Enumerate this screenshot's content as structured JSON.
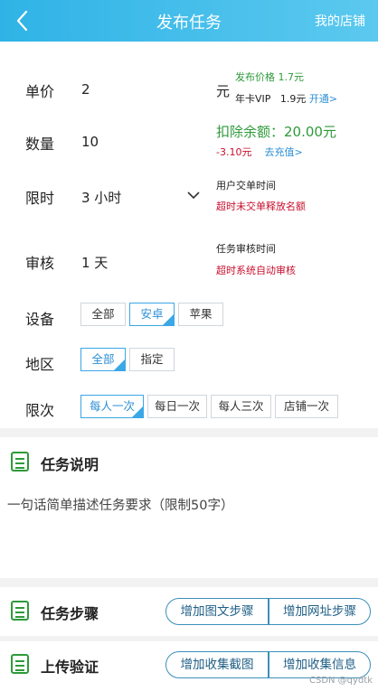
{
  "header": {
    "title": "发布任务",
    "right_link": "我的店铺"
  },
  "form": {
    "price": {
      "label": "单价",
      "value": "2",
      "unit": "元"
    },
    "publish_price": "发布价格 1.7元",
    "vip": {
      "text": "年卡VIP",
      "price": "1.9元",
      "link": "开通>"
    },
    "quantity": {
      "label": "数量",
      "value": "10"
    },
    "deduct": "扣除余额：20.00元",
    "balance": {
      "amount": "-3.10元",
      "link": "去充值>"
    },
    "time_limit": {
      "label": "限时",
      "value": "3 小时"
    },
    "time_note": {
      "line1": "用户交单时间",
      "line2": "超时未交单释放名额"
    },
    "review": {
      "label": "审核",
      "value": "1 天"
    },
    "review_note": {
      "line1": "任务审核时间",
      "line2": "超时系统自动审核"
    },
    "device": {
      "label": "设备",
      "options": [
        "全部",
        "安卓",
        "苹果"
      ],
      "selected": "安卓"
    },
    "region": {
      "label": "地区",
      "options": [
        "全部",
        "指定"
      ],
      "selected": "全部"
    },
    "limit": {
      "label": "限次",
      "options": [
        "每人一次",
        "每日一次",
        "每人三次",
        "店铺一次"
      ],
      "selected": "每人一次"
    }
  },
  "description": {
    "title": "任务说明",
    "placeholder": "一句话简单描述任务要求（限制50字）"
  },
  "steps": {
    "title": "任务步骤",
    "buttons": [
      "增加图文步骤",
      "增加网址步骤"
    ]
  },
  "upload": {
    "title": "上传验证",
    "buttons": [
      "增加收集截图",
      "增加收集信息"
    ]
  },
  "watermark": "CSDN @qydtk",
  "colors": {
    "header": "#2fb3e6",
    "green": "#2e9a3a",
    "red": "#c8102e",
    "blue": "#2d8fd6"
  }
}
